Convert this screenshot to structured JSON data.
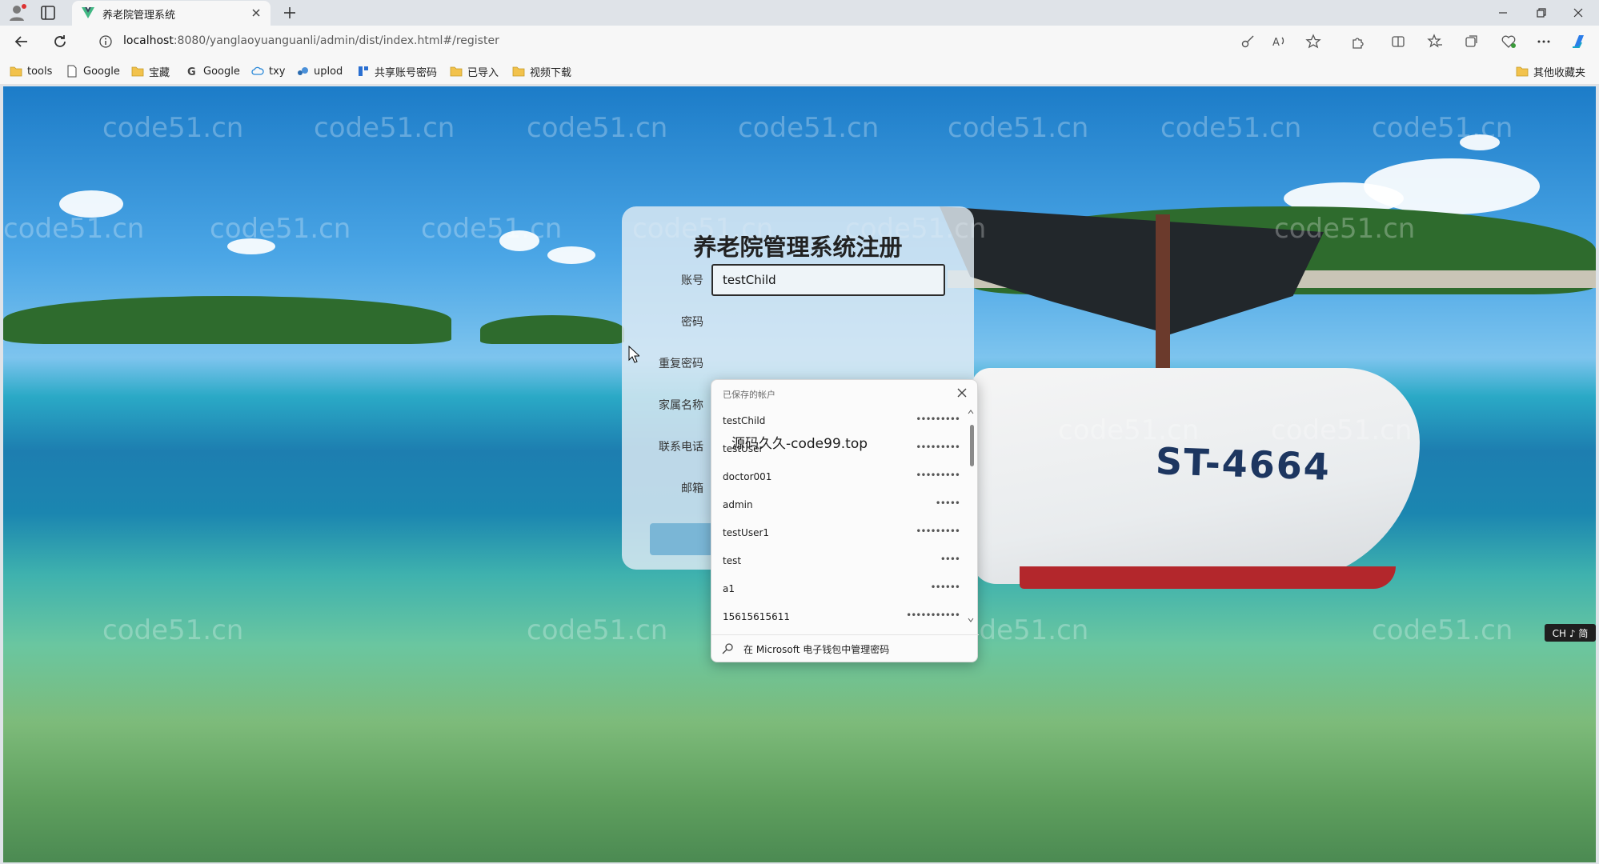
{
  "browser": {
    "tab_title": "养老院管理系统",
    "url_host": "localhost",
    "url_rest": ":8080/yanglaoyuanguanli/admin/dist/index.html#/register",
    "bookmarks": [
      "tools",
      "Google",
      "宝藏",
      "Google",
      "txy",
      "uplod",
      "共享账号密码",
      "已导入",
      "视频下载"
    ],
    "other_bookmarks": "其他收藏夹"
  },
  "watermark": "code51.cn",
  "boat_label": "ST-4664",
  "form": {
    "title": "养老院管理系统注册",
    "fields": [
      {
        "label": "账号",
        "value": "testChild"
      },
      {
        "label": "密码",
        "value": ""
      },
      {
        "label": "重复密码",
        "value": ""
      },
      {
        "label": "家属名称",
        "value": ""
      },
      {
        "label": "联系电话",
        "value": ""
      },
      {
        "label": "邮箱",
        "value": ""
      }
    ]
  },
  "saved_accounts": {
    "header": "已保存的帐户",
    "items": [
      {
        "user": "testChild",
        "pass": "•••••••••"
      },
      {
        "user": "testUser",
        "pass": "•••••••••"
      },
      {
        "user": "doctor001",
        "pass": "•••••••••"
      },
      {
        "user": "admin",
        "pass": "•••••"
      },
      {
        "user": "testUser1",
        "pass": "•••••••••"
      },
      {
        "user": "test",
        "pass": "••••"
      },
      {
        "user": "a1",
        "pass": "••••••"
      },
      {
        "user": "15615615611",
        "pass": "•••••••••••"
      }
    ],
    "footer": "在 Microsoft 电子钱包中管理密码"
  },
  "overlay_text": "源码久久-code99.top",
  "ime_indicator": "CH ♪ 简"
}
